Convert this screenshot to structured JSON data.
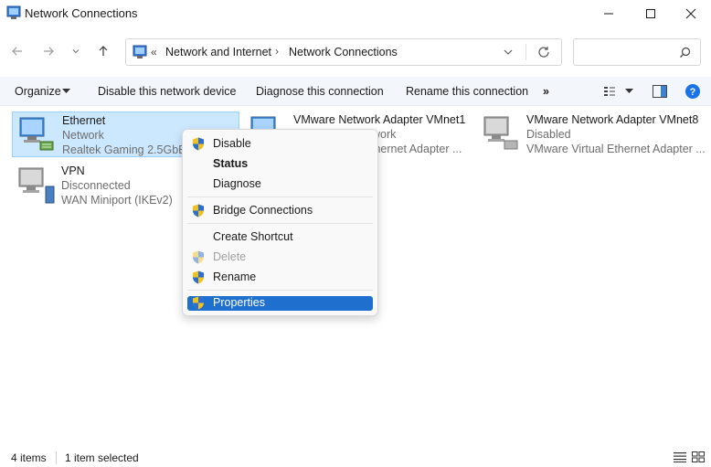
{
  "window": {
    "title": "Network Connections",
    "controls": [
      "minimize",
      "maximize",
      "close"
    ]
  },
  "address": {
    "overflow": "«",
    "crumbs": [
      "Network and Internet",
      "Network Connections"
    ],
    "search_placeholder": ""
  },
  "commands": {
    "organize": "Organize",
    "disable": "Disable this network device",
    "diagnose": "Diagnose this connection",
    "rename": "Rename this connection",
    "more": "»"
  },
  "items": [
    {
      "name": "Ethernet",
      "status": "Network",
      "device": "Realtek Gaming 2.5GbE F",
      "selected": true
    },
    {
      "name": "VMware Network Adapter VMnet1",
      "status": "work",
      "device": "thernet Adapter ...",
      "selected": false
    },
    {
      "name": "VMware Network Adapter VMnet8",
      "status": "Disabled",
      "device": "VMware Virtual Ethernet Adapter ...",
      "selected": false
    },
    {
      "name": "VPN",
      "status": "Disconnected",
      "device": "WAN Miniport (IKEv2)",
      "selected": false
    }
  ],
  "context_menu": {
    "disable": "Disable",
    "status": "Status",
    "diagnose": "Diagnose",
    "bridge": "Bridge Connections",
    "shortcut": "Create Shortcut",
    "delete": "Delete",
    "rename": "Rename",
    "properties": "Properties"
  },
  "statusbar": {
    "count": "4 items",
    "selection": "1 item selected"
  },
  "colors": {
    "selection_bg": "#cce8ff",
    "selection_border": "#99d1ff",
    "menu_highlight": "#1f6fcf",
    "cmdbar_bg": "#f3f6fa",
    "help_blue": "#1a73e8"
  }
}
